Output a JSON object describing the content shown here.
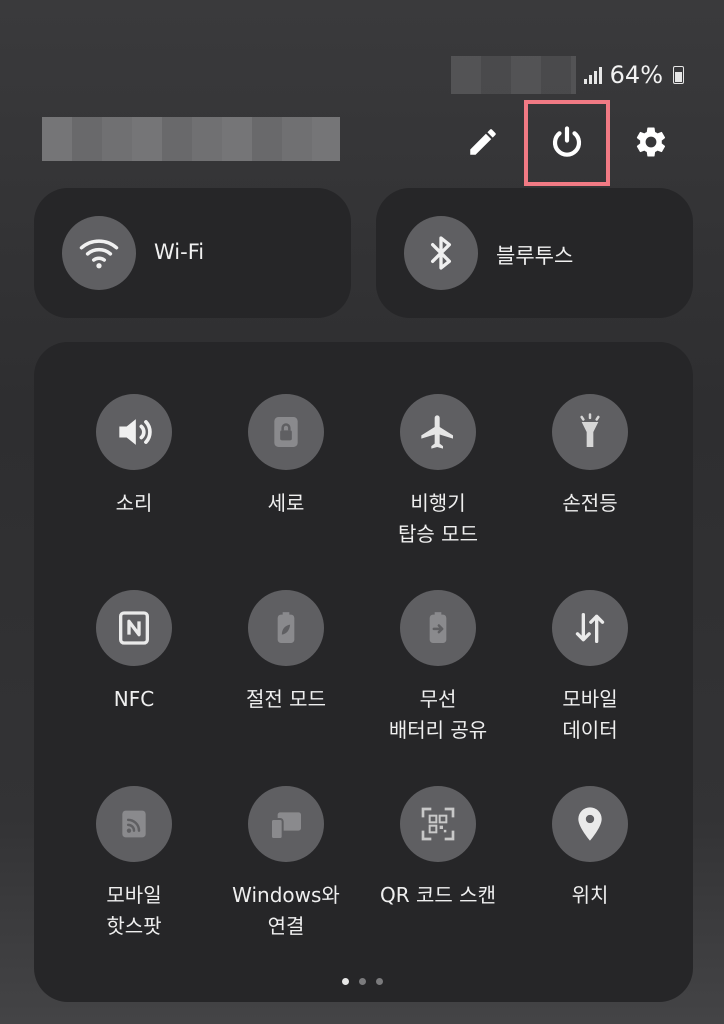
{
  "status_bar": {
    "battery_percent": "64%"
  },
  "header": {
    "edit_icon": "pencil-icon",
    "power_icon": "power-icon",
    "settings_icon": "gear-icon",
    "highlight_color": "#f17a84"
  },
  "tiles": {
    "wifi": {
      "label": "Wi-Fi",
      "icon": "wifi-icon"
    },
    "bluetooth": {
      "label": "블루투스",
      "icon": "bluetooth-icon"
    }
  },
  "quick_settings": [
    {
      "line1": "소리",
      "line2": "",
      "icon": "speaker-icon"
    },
    {
      "line1": "세로",
      "line2": "",
      "icon": "lock-rotation-icon"
    },
    {
      "line1": "비행기",
      "line2": "탑승 모드",
      "icon": "airplane-icon"
    },
    {
      "line1": "손전등",
      "line2": "",
      "icon": "flashlight-icon"
    },
    {
      "line1": "NFC",
      "line2": "",
      "icon": "nfc-icon"
    },
    {
      "line1": "절전 모드",
      "line2": "",
      "icon": "power-saving-icon"
    },
    {
      "line1": "무선",
      "line2": "배터리 공유",
      "icon": "wireless-powershare-icon"
    },
    {
      "line1": "모바일",
      "line2": "데이터",
      "icon": "mobile-data-icon"
    },
    {
      "line1": "모바일",
      "line2": "핫스팟",
      "icon": "hotspot-icon"
    },
    {
      "line1": "Windows와",
      "line2": "연결",
      "icon": "link-to-windows-icon"
    },
    {
      "line1": "QR 코드 스캔",
      "line2": "",
      "icon": "qr-scan-icon"
    },
    {
      "line1": "위치",
      "line2": "",
      "icon": "location-icon"
    }
  ],
  "pagination": {
    "pages": 3,
    "current": 1
  }
}
